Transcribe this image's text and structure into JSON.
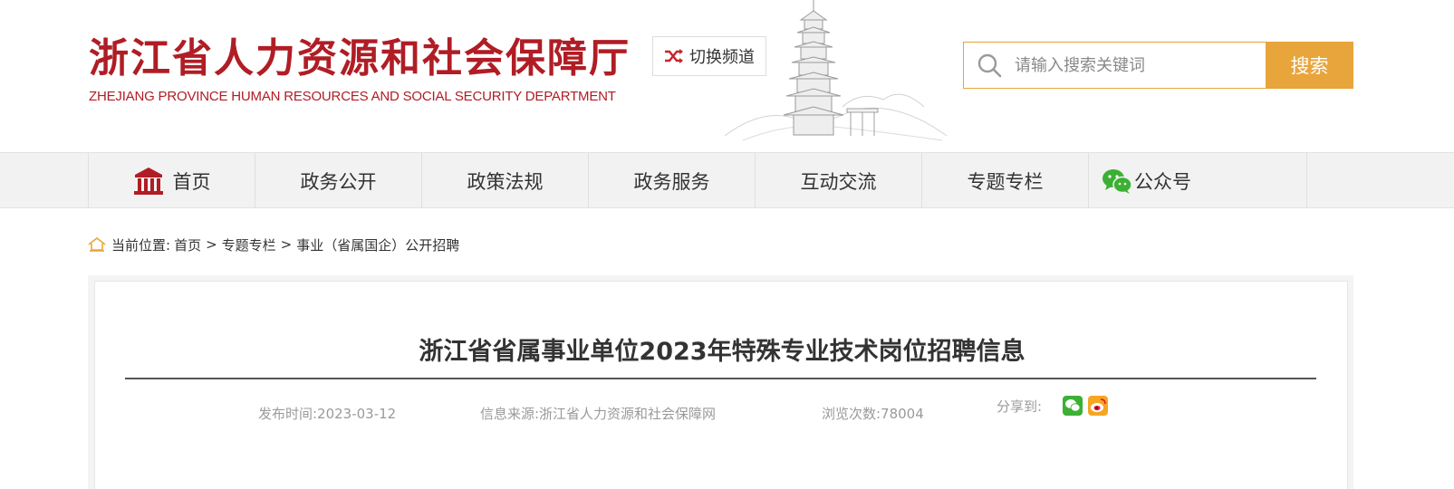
{
  "header": {
    "logo_cn": "浙江省人力资源和社会保障厅",
    "logo_en": "ZHEJIANG PROVINCE HUMAN RESOURCES AND SOCIAL SECURITY DEPARTMENT",
    "switch_label": "切换频道",
    "search": {
      "placeholder": "请输入搜索关键词",
      "value": "",
      "button_label": "搜索"
    }
  },
  "nav": {
    "items": [
      {
        "label": "首页",
        "icon": "home-building-icon"
      },
      {
        "label": "政务公开"
      },
      {
        "label": "政策法规"
      },
      {
        "label": "政务服务"
      },
      {
        "label": "互动交流"
      },
      {
        "label": "专题专栏"
      },
      {
        "label": "公众号",
        "icon": "wechat-icon"
      }
    ]
  },
  "breadcrumb": {
    "prefix": "当前位置:",
    "items": [
      "首页",
      "专题专栏",
      "事业（省属国企）公开招聘"
    ],
    "separator": ">"
  },
  "article": {
    "title": "浙江省省属事业单位2023年特殊专业技术岗位招聘信息",
    "publish_time": "发布时间:2023-03-12",
    "source": "信息来源:浙江省人力资源和社会保障网",
    "views": "浏览次数:78004",
    "share_label": "分享到:"
  },
  "colors": {
    "brand_red": "#b01d25",
    "accent_orange": "#e8a53c",
    "nav_bg": "#f2f2f2",
    "meta_gray": "#9a9a9a"
  }
}
